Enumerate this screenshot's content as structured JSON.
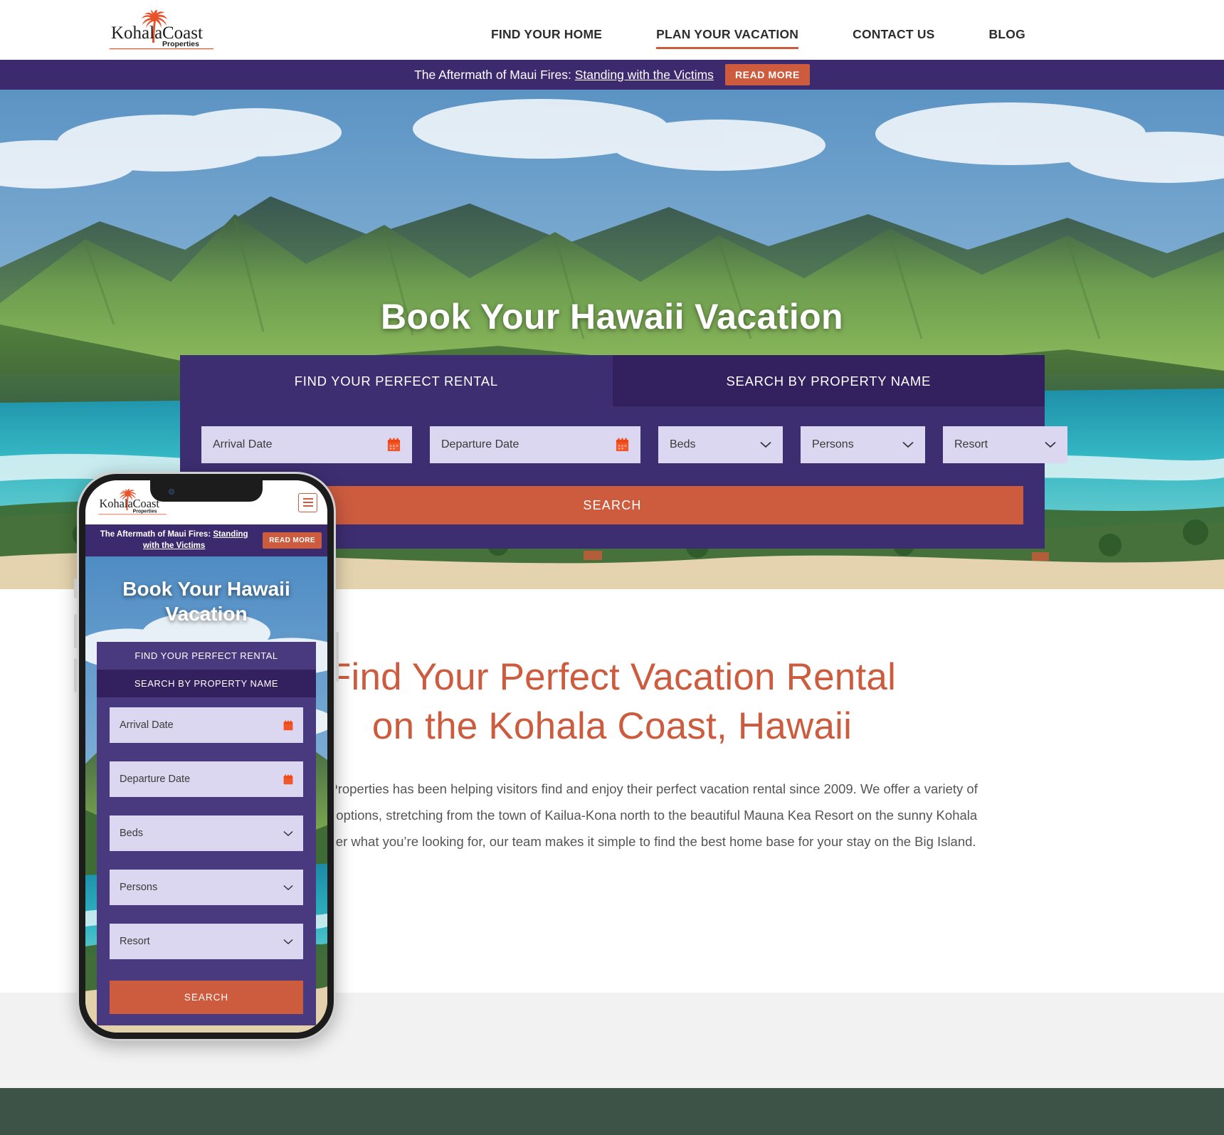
{
  "header": {
    "logo_primary": "Kohala",
    "logo_secondary": "Coast",
    "logo_tagline": "Properties",
    "nav": [
      {
        "label": "FIND YOUR HOME",
        "active": false
      },
      {
        "label": "PLAN YOUR VACATION",
        "active": true
      },
      {
        "label": "CONTACT US",
        "active": false
      },
      {
        "label": "BLOG",
        "active": false
      }
    ]
  },
  "announcement": {
    "prefix": "The Aftermath of Maui Fires:",
    "link_text": "Standing with the Victims",
    "button_label": "READ MORE",
    "bar_color": "#3b2a6e",
    "button_color": "#cd5c3f"
  },
  "hero": {
    "title": "Book Your Hawaii Vacation"
  },
  "search_panel": {
    "tabs": [
      {
        "label": "FIND YOUR PERFECT RENTAL",
        "active": true
      },
      {
        "label": "SEARCH BY PROPERTY NAME",
        "active": false
      }
    ],
    "fields": [
      {
        "name": "arrival-date",
        "placeholder": "Arrival Date",
        "icon": "calendar-icon",
        "type": "date"
      },
      {
        "name": "departure-date",
        "placeholder": "Departure Date",
        "icon": "calendar-icon",
        "type": "date"
      },
      {
        "name": "beds",
        "placeholder": "Beds",
        "icon": "chevron-down-icon",
        "type": "select"
      },
      {
        "name": "persons",
        "placeholder": "Persons",
        "icon": "chevron-down-icon",
        "type": "select"
      },
      {
        "name": "resort",
        "placeholder": "Resort",
        "icon": "chevron-down-icon",
        "type": "select"
      }
    ],
    "search_label": "SEARCH",
    "panel_color": "#3d2e72",
    "inactive_tab_color": "#33215f",
    "field_color": "#dcd7f0",
    "accent_color": "#cd5c3f"
  },
  "content": {
    "heading_line1": "Find Your Perfect Vacation Rental",
    "heading_line2": "on the Kohala Coast, Hawaii",
    "heading_color": "#cd5c3f",
    "paragraph": "Kohala Coast Properties has been helping visitors find and enjoy their perfect vacation rental since 2009. We offer a variety of vacation rental options, stretching from the town of Kailua-Kona north to the beautiful Mauna Kea Resort on the sunny Kohala Coast. No matter what you’re looking for, our team makes it simple to find the best home base for your stay on the Big Island."
  },
  "phone_mockup": {
    "announcement": {
      "prefix": "The Aftermath of Maui Fires:",
      "link_text": "Standing with the Victims",
      "button_label": "READ MORE"
    },
    "hero_title_line1": "Book Your Hawaii",
    "hero_title_line2": "Vacation",
    "tabs": [
      {
        "label": "FIND YOUR PERFECT RENTAL",
        "active": true
      },
      {
        "label": "SEARCH BY PROPERTY NAME",
        "active": false
      }
    ],
    "fields": [
      {
        "name": "arrival-date",
        "placeholder": "Arrival Date",
        "icon": "calendar-icon"
      },
      {
        "name": "departure-date",
        "placeholder": "Departure Date",
        "icon": "calendar-icon"
      },
      {
        "name": "beds",
        "placeholder": "Beds",
        "icon": "chevron-down-icon"
      },
      {
        "name": "persons",
        "placeholder": "Persons",
        "icon": "chevron-down-icon"
      },
      {
        "name": "resort",
        "placeholder": "Resort",
        "icon": "chevron-down-icon"
      }
    ],
    "search_label": "SEARCH",
    "menu_icon": "hamburger-menu-icon"
  },
  "bands": {
    "gray": "#f2f2f2",
    "green": "#3d5347"
  }
}
